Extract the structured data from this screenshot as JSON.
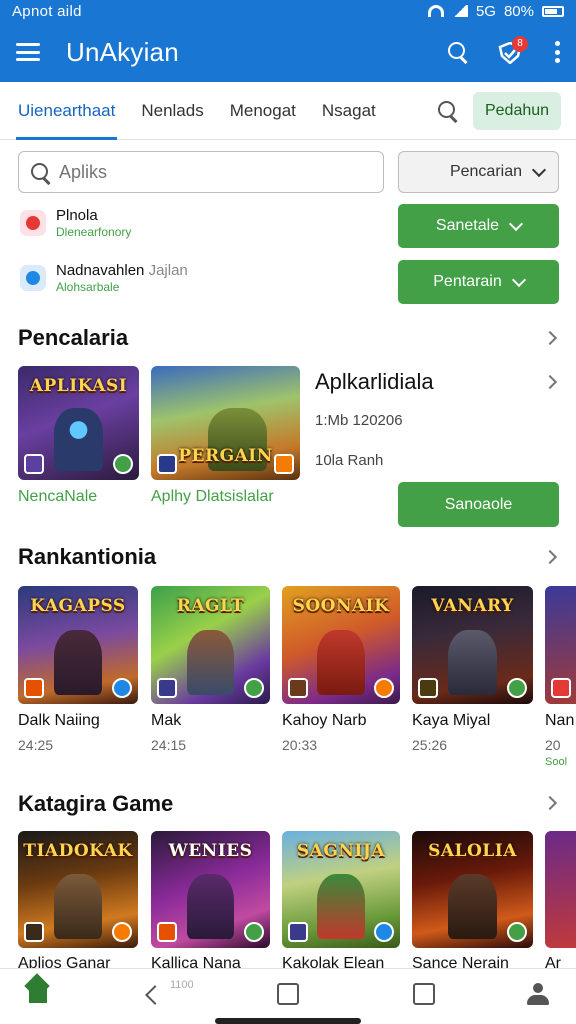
{
  "status_bar": {
    "time": "Apnot aild",
    "network": "5G",
    "battery": "80%"
  },
  "app_bar": {
    "title": "UnAkyian",
    "badge": "8"
  },
  "tabs": {
    "items": [
      {
        "label": "Uienearthaat"
      },
      {
        "label": "Nenlads"
      },
      {
        "label": "Menogat"
      },
      {
        "label": "Nsagat"
      }
    ],
    "button_label": "Pedahun"
  },
  "search": {
    "placeholder": "Apliks",
    "dropdown_label": "Pencarian"
  },
  "app_rows": [
    {
      "name": "Plnola",
      "sub": "Dlenearfonory",
      "button": "Sanetale",
      "icon_color": "#e53935"
    },
    {
      "name": "Nadnavahlen",
      "name_extra": "Jajlan",
      "sub": "Alohsarbale",
      "button": "Pentarain",
      "icon_color": "#1e88e5"
    }
  ],
  "featured": {
    "title": "Pencalaria",
    "cards": [
      {
        "title_art": "APLIKASI",
        "caption": "NencaNale"
      },
      {
        "title_art": "PERGAIN",
        "caption": "Aplhy Dlatsislalar"
      }
    ],
    "detail_title": "Aplkarlidiala",
    "detail_line1": "1:Mb 120206",
    "detail_line2": "10la Ranh",
    "detail_button": "Sanoaole"
  },
  "ranking": {
    "title": "Rankantionia",
    "items": [
      {
        "title_art": "KAGAPSS",
        "name": "Dalk Naiing",
        "meta": "24:25"
      },
      {
        "title_art": "RAGLT",
        "name": "Mak",
        "meta": "24:15"
      },
      {
        "title_art": "SOONAIK",
        "name": "Kahoy Narb",
        "meta": "20:33"
      },
      {
        "title_art": "VANARY",
        "name": "Kaya Miyal",
        "meta": "25:26"
      },
      {
        "title_art": "",
        "name": "Nan",
        "meta": "20",
        "extra": "Sool"
      }
    ]
  },
  "category": {
    "title": "Katagira Game",
    "items": [
      {
        "title_art": "TIADOKAK",
        "name": "Aplios Ganar"
      },
      {
        "title_art": "WENIES",
        "name": "Kallica Nana"
      },
      {
        "title_art": "SAGNIJA",
        "name": "Kakolak Elean"
      },
      {
        "title_art": "SALOLIA",
        "name": "Sance Nerain"
      },
      {
        "title_art": "",
        "name": "Ar"
      }
    ],
    "sub_text": "1100"
  },
  "colors": {
    "primary": "#1976d2",
    "accent_green": "#43a047",
    "pale_green": "#d9efe2"
  }
}
